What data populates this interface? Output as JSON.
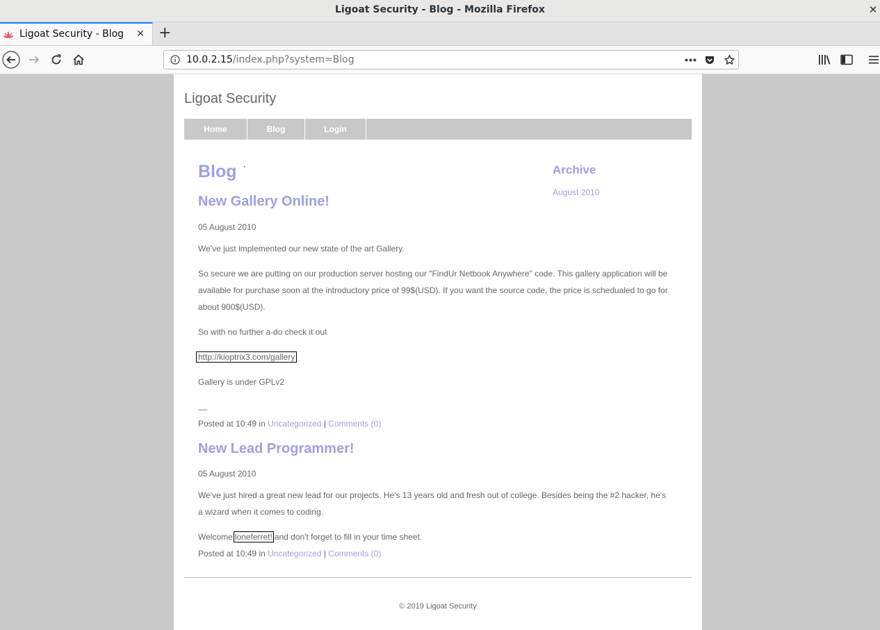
{
  "window": {
    "title": "Ligoat Security - Blog - Mozilla Firefox",
    "close_icon": "close-icon"
  },
  "tabs": [
    {
      "label": "Ligoat Security - Blog",
      "close": "✕"
    }
  ],
  "new_tab_label": "+",
  "urlbar": {
    "host": "10.0.2.15",
    "path": "/index.php?system=Blog",
    "page_actions": "•••"
  },
  "site": {
    "title": "Ligoat Security",
    "menu": [
      "Home",
      "Blog",
      "Login"
    ]
  },
  "blog": {
    "heading": "Blog",
    "dot": "·",
    "posts": [
      {
        "title": "New Gallery Online!",
        "date": "05 August 2010",
        "p1": "We've just implemented our new state of the art Gallery.",
        "p2a": "So secure we are putting on our production server hosting our \"FindUr Netbook Anywhere\" code. This gallery application will be",
        "p2b": "available for purchase soon at the introductory price of 99$(USD). If you want the source code, the price is schedualed to go for",
        "p2c": "about 900$(USD).",
        "p3": "So with no further a-do check it out",
        "link": "http://kioptrix3.com/gallery",
        "p4": "Gallery is under GPLv2",
        "sep": "__",
        "posted": "Posted at 10:49 in",
        "category": "Uncategorized",
        "pipe": "|",
        "comments": "Comments (0)"
      },
      {
        "title": "New Lead Programmer!",
        "date": "05 August 2010",
        "p1a": "We've just hired a great new lead for our projects. He's 13 years old and fresh out of college. Besides being the #2 hacker, he's",
        "p1b": "a wizard when it comes to coding.",
        "welcome": "Welcome",
        "name": "loneferret!",
        "welcome_tail": "and don't forget to fill in your time sheet.",
        "posted": "Posted at 10:49 in",
        "category": "Uncategorized",
        "pipe": "|",
        "comments": "Comments (0)"
      }
    ]
  },
  "sidebar": {
    "title": "Archive",
    "link": "August 2010"
  },
  "footer": "© 2019 Ligoat Security",
  "colors": {
    "accent": "#a0a0dc",
    "text": "#666666",
    "menu": "#c8c8c8",
    "tab_highlight": "#0a84ff"
  }
}
